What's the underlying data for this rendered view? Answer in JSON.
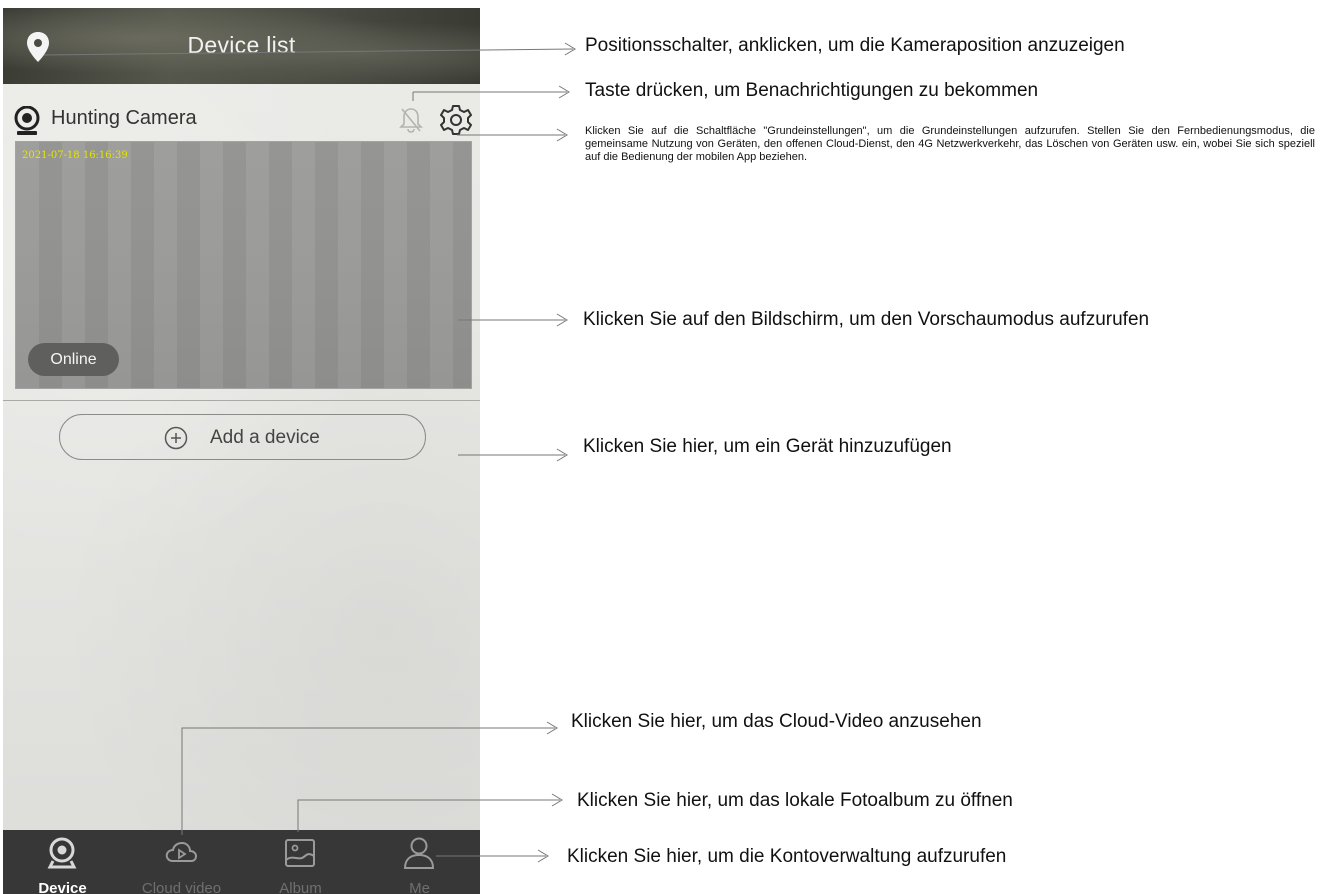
{
  "header": {
    "title": "Device list",
    "left_icon": "location-pin-icon"
  },
  "device": {
    "name": "Hunting Camera",
    "timestamp": "2021-07-18 16:16:39",
    "status": "Online",
    "icons": [
      "webcam-icon",
      "bell-off-icon",
      "gear-icon"
    ]
  },
  "add_device": {
    "label": "Add a device",
    "icon": "plus-circle-icon"
  },
  "tabs": [
    {
      "label": "Device",
      "icon": "device-camera-icon",
      "active": true
    },
    {
      "label": "Cloud video",
      "icon": "cloud-play-icon",
      "active": false
    },
    {
      "label": "Album",
      "icon": "album-icon",
      "active": false
    },
    {
      "label": "Me",
      "icon": "person-icon",
      "active": false
    }
  ],
  "annotations": {
    "location": "Positionsschalter, anklicken, um die Kameraposition anzuzeigen",
    "notifications": "Taste drücken, um Benachrichtigungen zu bekommen",
    "settings": "Klicken Sie auf die Schaltfläche \"Grundeinstellungen\", um die Grundeinstellungen aufzurufen. Stellen Sie den Fernbedienungsmodus, die gemeinsame Nutzung von Geräten, den offenen Cloud-Dienst, den 4G Netzwerkverkehr, das Löschen von Geräten usw. ein, wobei Sie sich speziell auf die Bedienung der mobilen App beziehen.",
    "preview": "Klicken Sie auf den Bildschirm, um den Vorschaumodus aufzurufen",
    "add_device": "Klicken Sie hier, um ein Gerät hinzuzufügen",
    "cloud_video": "Klicken Sie hier, um das Cloud-Video anzusehen",
    "album": "Klicken Sie hier, um das lokale Fotoalbum zu öffnen",
    "account": "Klicken Sie hier, um die Kontoverwaltung aufzurufen"
  },
  "colors": {
    "header_bg": "#4a4c43",
    "tabbar_bg": "#373737",
    "timestamp": "#e6e600",
    "badge_bg": "#5f5f5e"
  }
}
